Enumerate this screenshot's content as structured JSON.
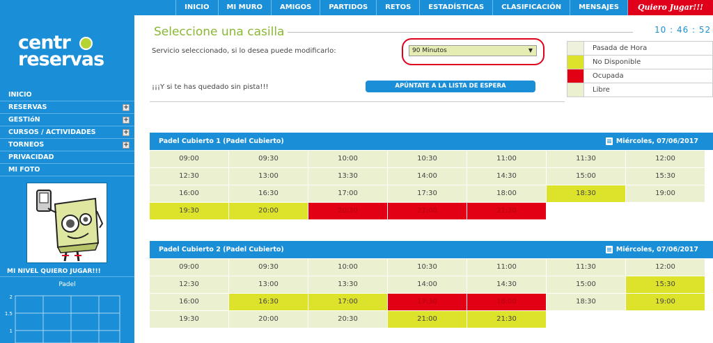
{
  "nav": {
    "items": [
      "INICIO",
      "MI MURO",
      "AMIGOS",
      "PARTIDOS",
      "RETOS",
      "ESTADÍSTICAS",
      "CLASIFICACIÓN",
      "MENSAJES"
    ],
    "cta": "Quiero Jugar!!!"
  },
  "sidebar": {
    "logo_top": "centr",
    "logo_bottom": "reservas",
    "menu": [
      {
        "label": "INICIO",
        "expandable": false
      },
      {
        "label": "RESERVAS",
        "expandable": true
      },
      {
        "label": "GESTIóN",
        "expandable": true
      },
      {
        "label": "CURSOS / ACTIVIDADES",
        "expandable": true
      },
      {
        "label": "TORNEOS",
        "expandable": true
      },
      {
        "label": "PRIVACIDAD",
        "expandable": false
      },
      {
        "label": "MI FOTO",
        "expandable": false
      }
    ],
    "plus_symbol": "+",
    "nivel_title": "MI NIVEL QUIERO JUGAR!!!",
    "nivel_sport": "Padel",
    "nivel_ticks": [
      "2",
      "1.5",
      "1"
    ]
  },
  "main": {
    "title": "Seleccione una casilla",
    "clock": "10 : 46 : 52",
    "service_prompt": "Servicio seleccionado, si lo desea puede modificarlo:",
    "service_value": "90 Minutos",
    "service_arrow": "▼",
    "waitlist_prompt": "¡¡¡Y si te has quedado sin pista!!!",
    "waitlist_button": "APÚNTATE A LA LISTA DE ESPERA"
  },
  "legend": [
    {
      "label": "Pasada de Hora",
      "color": "#eef2dc"
    },
    {
      "label": "No Disponible",
      "color": "#dde22a"
    },
    {
      "label": "Ocupada",
      "color": "#e20014"
    },
    {
      "label": "Libre",
      "color": "#ebf0d0"
    }
  ],
  "courts": [
    {
      "name": "Padel Cubierto 1 (Padel Cubierto)",
      "date": "Miércoles, 07/06/2017",
      "slots": [
        {
          "time": "09:00",
          "status": "libre"
        },
        {
          "time": "09:30",
          "status": "libre"
        },
        {
          "time": "10:00",
          "status": "libre"
        },
        {
          "time": "10:30",
          "status": "libre"
        },
        {
          "time": "11:00",
          "status": "libre"
        },
        {
          "time": "11:30",
          "status": "libre"
        },
        {
          "time": "12:00",
          "status": "libre"
        },
        {
          "time": "12:30",
          "status": "libre"
        },
        {
          "time": "13:00",
          "status": "libre"
        },
        {
          "time": "13:30",
          "status": "libre"
        },
        {
          "time": "14:00",
          "status": "libre"
        },
        {
          "time": "14:30",
          "status": "libre"
        },
        {
          "time": "15:00",
          "status": "libre"
        },
        {
          "time": "15:30",
          "status": "libre"
        },
        {
          "time": "16:00",
          "status": "libre"
        },
        {
          "time": "16:30",
          "status": "libre"
        },
        {
          "time": "17:00",
          "status": "libre"
        },
        {
          "time": "17:30",
          "status": "libre"
        },
        {
          "time": "18:00",
          "status": "libre"
        },
        {
          "time": "18:30",
          "status": "no_disponible"
        },
        {
          "time": "19:00",
          "status": "libre"
        },
        {
          "time": "19:30",
          "status": "no_disponible"
        },
        {
          "time": "20:00",
          "status": "no_disponible"
        },
        {
          "time": "20:30",
          "status": "ocupada"
        },
        {
          "time": "21:00",
          "status": "ocupada"
        },
        {
          "time": "21:30",
          "status": "ocupada"
        }
      ]
    },
    {
      "name": "Padel Cubierto 2 (Padel Cubierto)",
      "date": "Miércoles, 07/06/2017",
      "slots": [
        {
          "time": "09:00",
          "status": "libre"
        },
        {
          "time": "09:30",
          "status": "libre"
        },
        {
          "time": "10:00",
          "status": "libre"
        },
        {
          "time": "10:30",
          "status": "libre"
        },
        {
          "time": "11:00",
          "status": "libre"
        },
        {
          "time": "11:30",
          "status": "libre"
        },
        {
          "time": "12:00",
          "status": "libre"
        },
        {
          "time": "12:30",
          "status": "libre"
        },
        {
          "time": "13:00",
          "status": "libre"
        },
        {
          "time": "13:30",
          "status": "libre"
        },
        {
          "time": "14:00",
          "status": "libre"
        },
        {
          "time": "14:30",
          "status": "libre"
        },
        {
          "time": "15:00",
          "status": "libre"
        },
        {
          "time": "15:30",
          "status": "no_disponible"
        },
        {
          "time": "16:00",
          "status": "libre"
        },
        {
          "time": "16:30",
          "status": "no_disponible"
        },
        {
          "time": "17:00",
          "status": "no_disponible"
        },
        {
          "time": "17:30",
          "status": "ocupada"
        },
        {
          "time": "18:00",
          "status": "ocupada"
        },
        {
          "time": "18:30",
          "status": "libre"
        },
        {
          "time": "19:00",
          "status": "no_disponible"
        },
        {
          "time": "19:30",
          "status": "libre"
        },
        {
          "time": "20:00",
          "status": "libre"
        },
        {
          "time": "20:30",
          "status": "libre"
        },
        {
          "time": "21:00",
          "status": "no_disponible"
        },
        {
          "time": "21:30",
          "status": "no_disponible"
        }
      ]
    }
  ]
}
